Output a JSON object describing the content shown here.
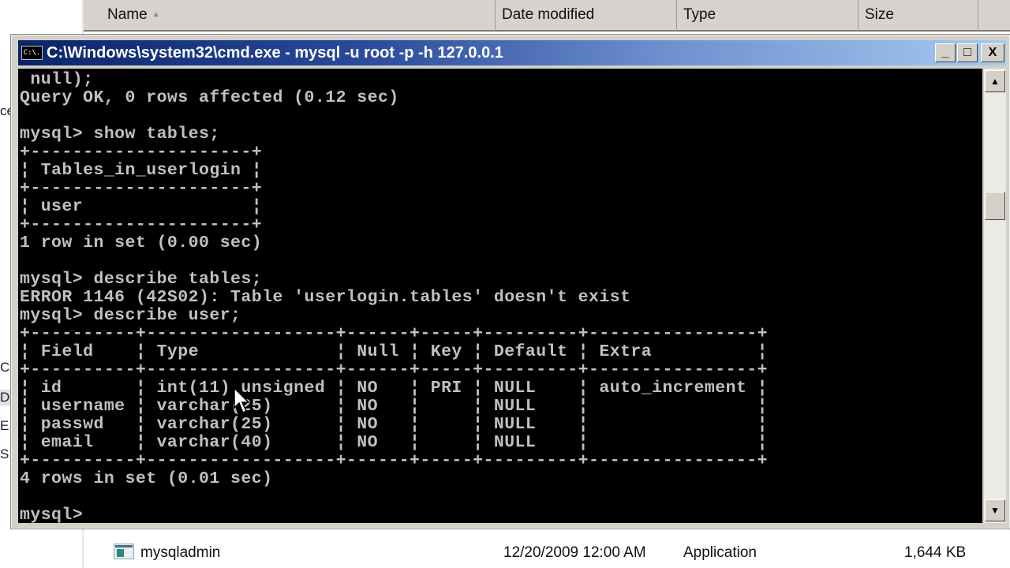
{
  "explorer": {
    "columns": [
      {
        "label": "Name",
        "sort": "ascending"
      },
      {
        "label": "Date modified"
      },
      {
        "label": "Type"
      },
      {
        "label": "Size"
      }
    ],
    "left_pane_fragments": [
      "ce",
      "C",
      "D",
      "E",
      "S:"
    ],
    "files": [
      {
        "name": "mysqladmin",
        "date_modified": "12/20/2009 12:00 AM",
        "type": "Application",
        "size": "1,644 KB",
        "icon": "application-icon"
      }
    ]
  },
  "cmd": {
    "icon_label": "C:\\.",
    "title": "C:\\Windows\\system32\\cmd.exe - mysql  -u root -p -h 127.0.0.1",
    "buttons": {
      "minimize": "_",
      "maximize": "□",
      "close": "X"
    },
    "scroll_up": "▲",
    "scroll_down": "▼",
    "lines": [
      " null);",
      "Query OK, 0 rows affected (0.12 sec)",
      "",
      "mysql> show tables;",
      "+---------------------+",
      "| Tables_in_userlogin |",
      "+---------------------+",
      "| user                |",
      "+---------------------+",
      "1 row in set (0.00 sec)",
      "",
      "mysql> describe tables;",
      "ERROR 1146 (42S02): Table 'userlogin.tables' doesn't exist",
      "mysql> describe user;",
      "+----------+------------------+------+-----+---------+----------------+",
      "| Field    | Type             | Null | Key | Default | Extra          |",
      "+----------+------------------+------+-----+---------+----------------+",
      "| id       | int(11) unsigned | NO   | PRI | NULL    | auto_increment |",
      "| username | varchar(25)      | NO   |     | NULL    |                |",
      "| passwd   | varchar(25)      | NO   |     | NULL    |                |",
      "| email    | varchar(40)      | NO   |     | NULL    |                |",
      "+----------+------------------+------+-----+---------+----------------+",
      "4 rows in set (0.01 sec)",
      "",
      "mysql>"
    ],
    "describe_user_table": {
      "headers": [
        "Field",
        "Type",
        "Null",
        "Key",
        "Default",
        "Extra"
      ],
      "rows": [
        [
          "id",
          "int(11) unsigned",
          "NO",
          "PRI",
          "NULL",
          "auto_increment"
        ],
        [
          "username",
          "varchar(25)",
          "NO",
          "",
          "NULL",
          ""
        ],
        [
          "passwd",
          "varchar(25)",
          "NO",
          "",
          "NULL",
          ""
        ],
        [
          "email",
          "varchar(40)",
          "NO",
          "",
          "NULL",
          ""
        ]
      ]
    },
    "prompt": "mysql>"
  }
}
